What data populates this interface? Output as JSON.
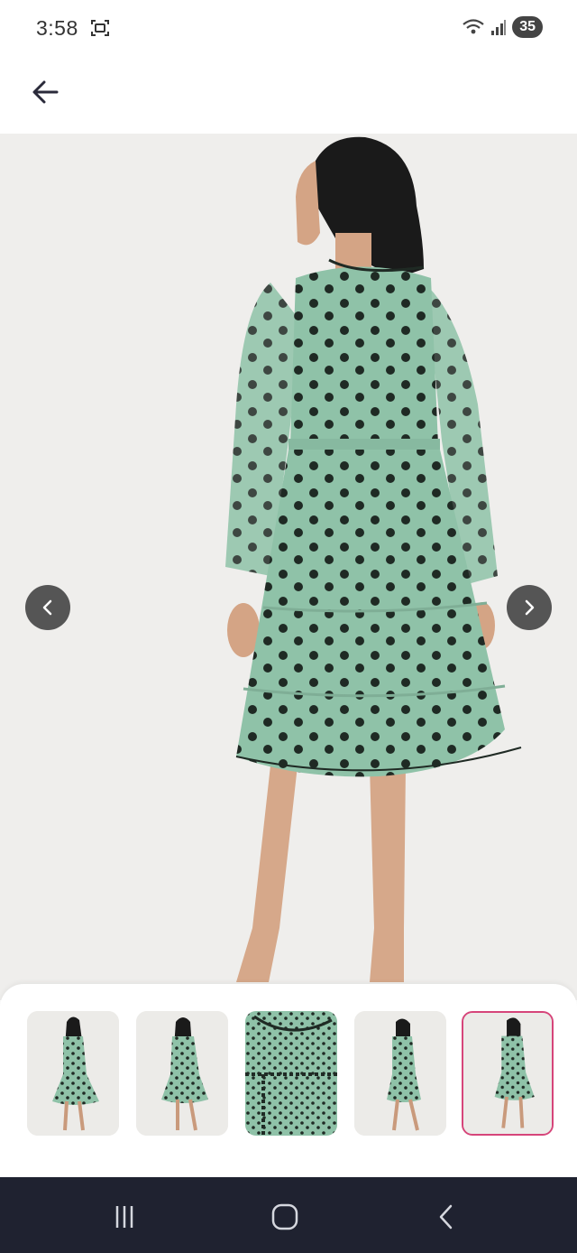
{
  "status_bar": {
    "time": "3:58",
    "battery": "35",
    "icons": [
      "screenshot-icon",
      "wifi-icon",
      "signal-icon",
      "battery-icon"
    ]
  },
  "app_bar": {
    "back_icon": "arrow-left-icon"
  },
  "gallery": {
    "prev_icon": "chevron-left-icon",
    "next_icon": "chevron-right-icon",
    "selected_index": 4,
    "thumbnail_count": 5
  },
  "system_nav": {
    "icons": [
      "recents-icon",
      "home-icon",
      "back-icon"
    ]
  },
  "colors": {
    "dress": "#8fc2a8",
    "dots": "#1f2a24",
    "background": "#efeeec",
    "selected_border": "#d6457a",
    "nav_bar": "#1f2230"
  }
}
